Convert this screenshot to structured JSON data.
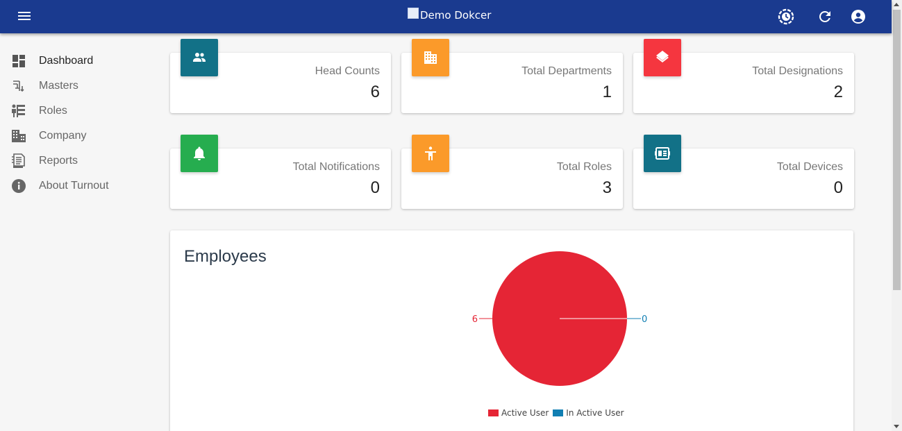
{
  "header": {
    "brand": "Demo Dokcer",
    "icons": [
      "menu-icon",
      "clock-settings-icon",
      "refresh-icon",
      "account-icon"
    ]
  },
  "sidebar": {
    "items": [
      {
        "label": "Dashboard",
        "icon": "dashboard-icon",
        "active": true
      },
      {
        "label": "Masters",
        "icon": "masters-icon"
      },
      {
        "label": "Roles",
        "icon": "roles-icon"
      },
      {
        "label": "Company",
        "icon": "company-icon"
      },
      {
        "label": "Reports",
        "icon": "reports-icon"
      },
      {
        "label": "About Turnout",
        "icon": "info-icon"
      }
    ]
  },
  "stats": [
    {
      "label": "Head Counts",
      "value": "6",
      "icon": "people-icon",
      "color": "#127187"
    },
    {
      "label": "Total Departments",
      "value": "1",
      "icon": "building-icon",
      "color": "#fb9a2a"
    },
    {
      "label": "Total Designations",
      "value": "2",
      "icon": "layers-icon",
      "color": "#f5363f"
    },
    {
      "label": "Total Notifications",
      "value": "0",
      "icon": "bell-icon",
      "color": "#26ad4f"
    },
    {
      "label": "Total Roles",
      "value": "3",
      "icon": "person-icon",
      "color": "#fb9a2a"
    },
    {
      "label": "Total Devices",
      "value": "0",
      "icon": "device-icon",
      "color": "#127187"
    }
  ],
  "employees": {
    "title": "Employees"
  },
  "chart_data": {
    "type": "pie",
    "categories": [
      "Active User",
      "In Active User"
    ],
    "values": [
      6,
      0
    ],
    "colors": [
      "#e52535",
      "#117fb3"
    ],
    "data_labels": [
      "6",
      "0"
    ],
    "legend": "bottom"
  }
}
